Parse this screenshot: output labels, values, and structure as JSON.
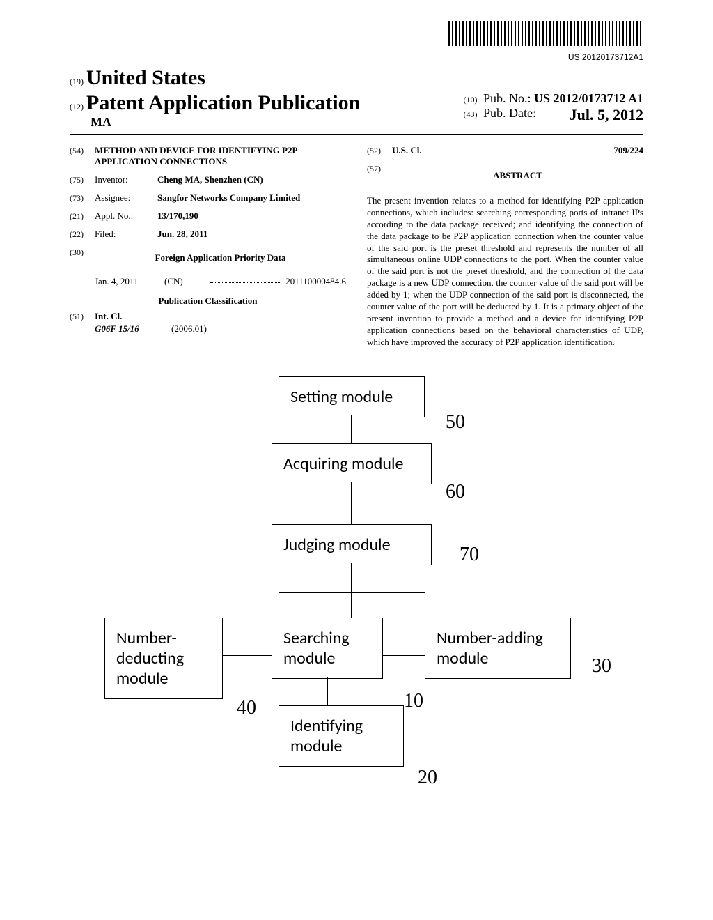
{
  "barcode_number": "US 20120173712A1",
  "header": {
    "inid_19": "(19)",
    "country": "United States",
    "inid_12": "(12)",
    "pub_title": "Patent Application Publication",
    "author": "MA",
    "inid_10": "(10)",
    "pub_no_label": "Pub. No.:",
    "pub_no": "US 2012/0173712 A1",
    "inid_43": "(43)",
    "pub_date_label": "Pub. Date:",
    "pub_date": "Jul. 5, 2012"
  },
  "biblio": {
    "inid_54": "(54)",
    "title": "METHOD AND DEVICE FOR IDENTIFYING P2P APPLICATION CONNECTIONS",
    "inid_75": "(75)",
    "inventor_label": "Inventor:",
    "inventor_value": "Cheng MA, Shenzhen (CN)",
    "inid_73": "(73)",
    "assignee_label": "Assignee:",
    "assignee_value": "Sangfor Networks Company Limited",
    "inid_21": "(21)",
    "appl_label": "Appl. No.:",
    "appl_value": "13/170,190",
    "inid_22": "(22)",
    "filed_label": "Filed:",
    "filed_value": "Jun. 28, 2011",
    "inid_30": "(30)",
    "foreign_heading": "Foreign Application Priority Data",
    "foreign_date": "Jan. 4, 2011",
    "foreign_country": "(CN)",
    "foreign_number": "201110000484.6",
    "pub_class_heading": "Publication Classification",
    "inid_51": "(51)",
    "int_cl_label": "Int. Cl.",
    "int_cl_code": "G06F 15/16",
    "int_cl_year": "(2006.01)",
    "inid_52": "(52)",
    "us_cl_label": "U.S. Cl.",
    "us_cl_value": "709/224",
    "inid_57": "(57)",
    "abstract_heading": "ABSTRACT",
    "abstract_text": "The present invention relates to a method for identifying P2P application connections, which includes: searching corresponding ports of intranet IPs according to the data package received; and identifying the connection of the data package to be P2P application connection when the counter value of the said port is the preset threshold and represents the number of all simultaneous online UDP connections to the port. When the counter value of the said port is not the preset threshold, and the connection of the data package is a new UDP connection, the counter value of the said port will be added by 1; when the UDP connection of the said port is disconnected, the counter value of the port will be deducted by 1. It is a primary object of the present invention to provide a method and a device for identifying P2P application connections based on the behavioral characteristics of UDP, which have improved the accuracy of P2P application identification."
  },
  "figure": {
    "box_setting": "Setting module",
    "box_acquiring": "Acquiring module",
    "box_judging": "Judging module",
    "box_deducting": "Number-deducting module",
    "box_searching": "Searching module",
    "box_adding": "Number-adding module",
    "box_identifying": "Identifying module",
    "ref_50": "50",
    "ref_60": "60",
    "ref_70": "70",
    "ref_30": "30",
    "ref_40": "40",
    "ref_10": "10",
    "ref_20": "20"
  }
}
